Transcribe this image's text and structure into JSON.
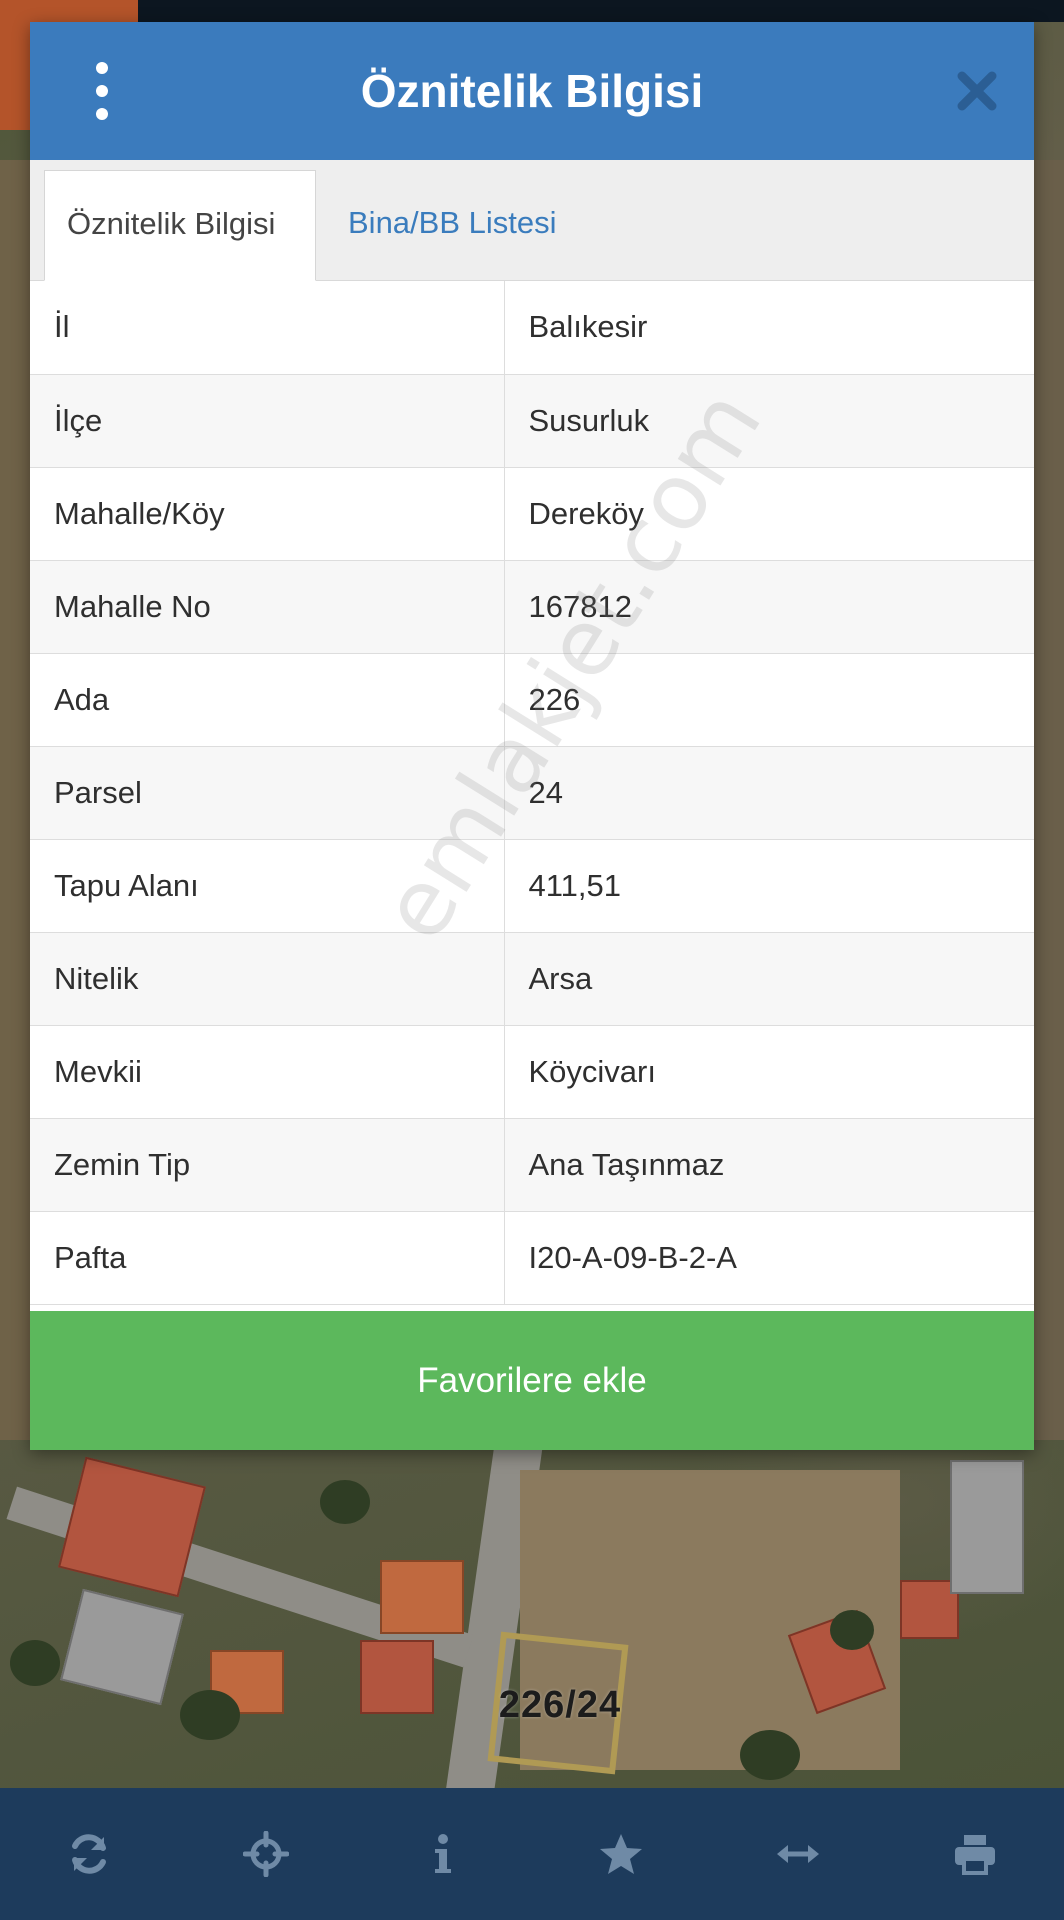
{
  "dialog": {
    "title": "Öznitelik Bilgisi",
    "menu_icon": "kebab-menu-icon",
    "close_icon": "close-icon",
    "header_color": "#3b7bbd"
  },
  "tabs": [
    {
      "label": "Öznitelik Bilgisi",
      "active": true
    },
    {
      "label": "Bina/BB Listesi",
      "active": false
    }
  ],
  "attributes": [
    {
      "key": "İl",
      "value": "Balıkesir"
    },
    {
      "key": "İlçe",
      "value": "Susurluk"
    },
    {
      "key": "Mahalle/Köy",
      "value": "Dereköy"
    },
    {
      "key": "Mahalle No",
      "value": "167812"
    },
    {
      "key": "Ada",
      "value": "226"
    },
    {
      "key": "Parsel",
      "value": "24"
    },
    {
      "key": "Tapu Alanı",
      "value": "411,51"
    },
    {
      "key": "Nitelik",
      "value": "Arsa"
    },
    {
      "key": "Mevkii",
      "value": "Köycivarı"
    },
    {
      "key": "Zemin Tip",
      "value": "Ana Taşınmaz"
    },
    {
      "key": "Pafta",
      "value": "I20-A-09-B-2-A"
    }
  ],
  "favorite_button": {
    "label": "Favorilere ekle",
    "color": "#5cb85c"
  },
  "watermark": "emlakjet.com",
  "map": {
    "parcel_label": "226/24"
  },
  "toolbar": {
    "color": "#1d3b5c",
    "icons": [
      "refresh-icon",
      "locate-crosshair-icon",
      "info-icon",
      "star-icon",
      "measure-arrows-icon",
      "print-icon"
    ]
  }
}
